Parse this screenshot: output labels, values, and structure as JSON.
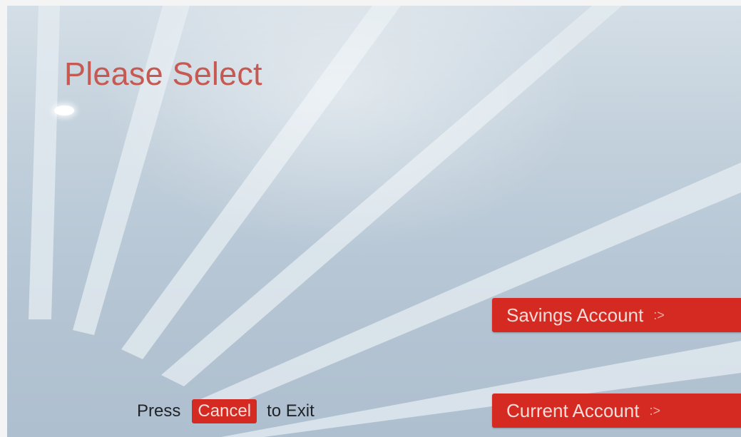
{
  "screen": {
    "title": "Please Select"
  },
  "options": [
    {
      "label": "Savings Account",
      "chevron": ":>"
    },
    {
      "label": "Current Account",
      "chevron": ":>"
    }
  ],
  "exit": {
    "prefix": "Press",
    "button_label": "Cancel",
    "suffix": "to Exit"
  },
  "colors": {
    "accent": "#d42a22",
    "title": "#c65a52",
    "background": "#c3d1dc"
  }
}
